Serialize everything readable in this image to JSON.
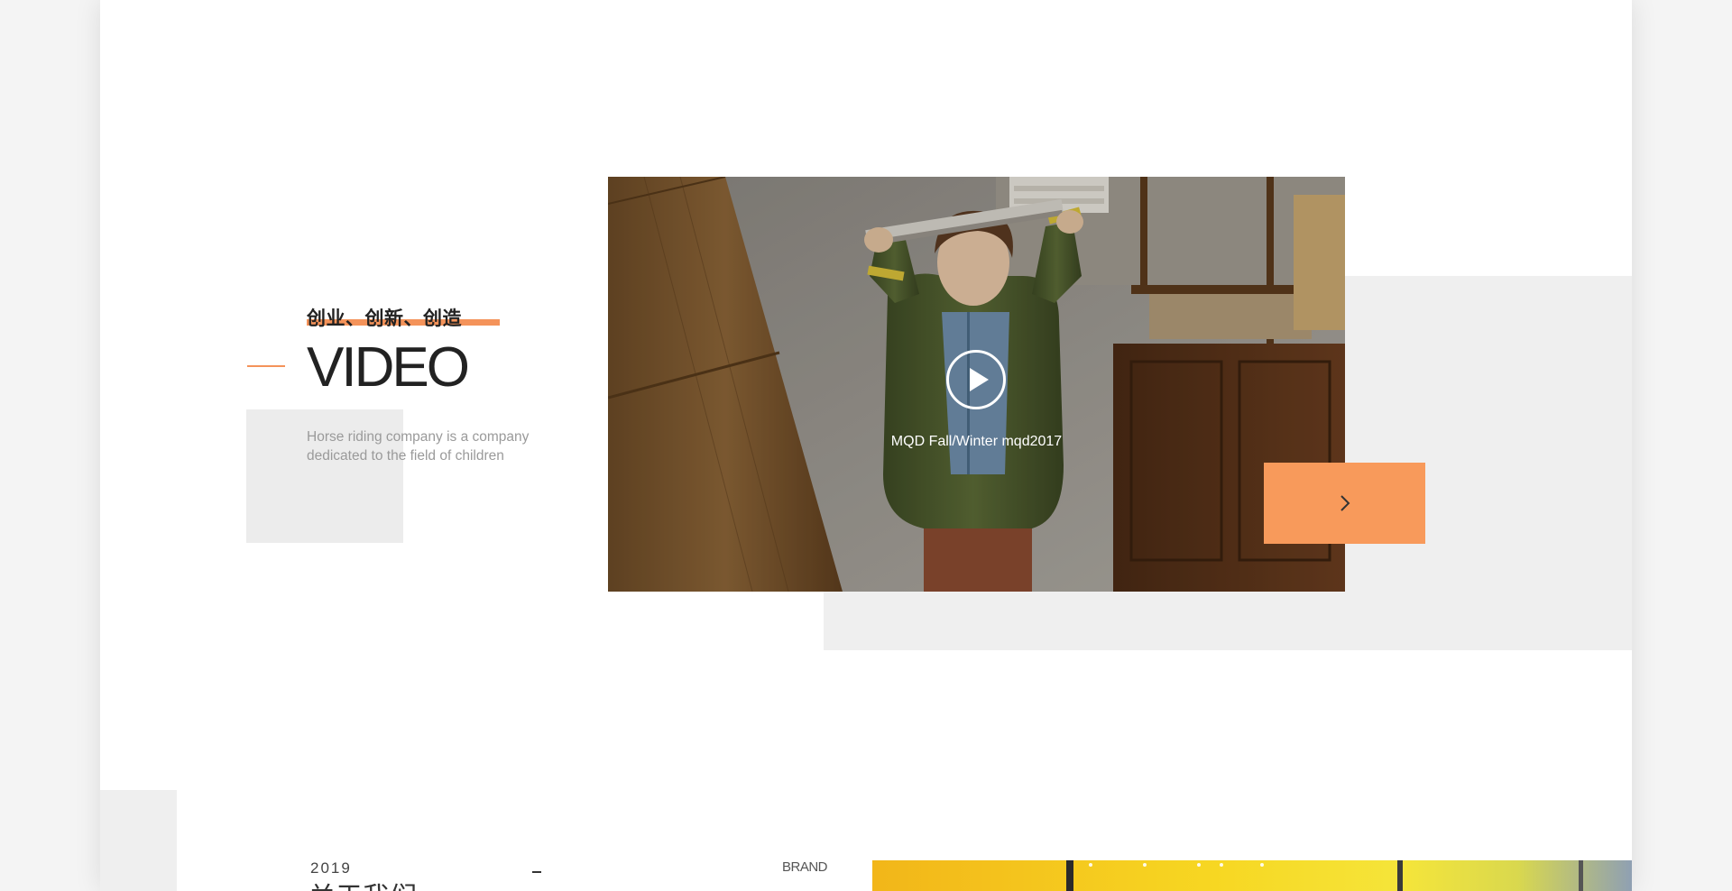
{
  "video_section": {
    "tagline": "创业、创新、创造",
    "heading": "VIDEO",
    "description": "Horse riding company is a company dedicated to the field of children",
    "video": {
      "caption": "MQD Fall/Winter mqd2017",
      "play_icon": "play-icon"
    },
    "next_icon": "chevron-right-icon"
  },
  "about_section": {
    "year": "2019",
    "title": "关于我们",
    "brand_label": "BRAND"
  },
  "colors": {
    "accent": "#f89a5b",
    "heading": "#222222",
    "description": "#9a9a9a",
    "panel": "#efefef"
  }
}
